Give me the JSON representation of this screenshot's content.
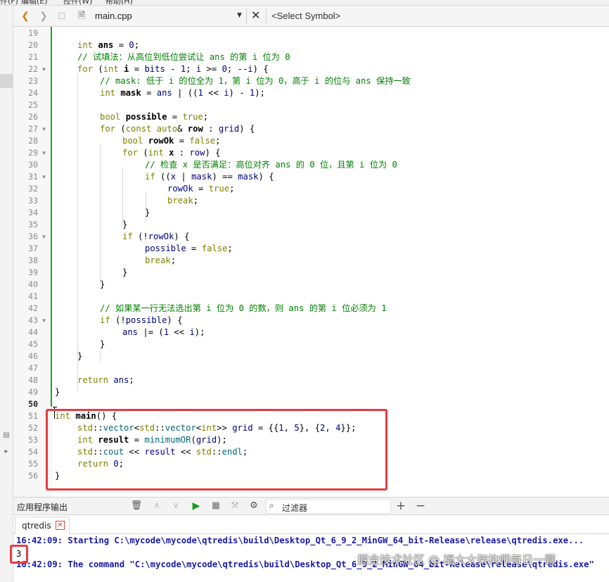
{
  "menubar": {
    "items": [
      "件(F)",
      "编辑(E)",
      "控件(W)",
      "帮助(H)"
    ]
  },
  "toolbar": {
    "file_name": "main.cpp",
    "symbol_placeholder": "<Select Symbol>",
    "icons": [
      "back-arrow-icon",
      "forward-arrow-icon",
      "lock-icon",
      "file-icon",
      "dropdown-icon",
      "close-icon"
    ]
  },
  "editor": {
    "current_line": 50,
    "lines": [
      {
        "n": "19",
        "text": ""
      },
      {
        "n": "20",
        "text": "int ans = 0;"
      },
      {
        "n": "21",
        "text": "// 试填法：从高位到低位尝试让 ans 的第 i 位为 0"
      },
      {
        "n": "22",
        "text": "for (int i = bits - 1; i >= 0; --i) {"
      },
      {
        "n": "23",
        "text": "// mask: 低于 i 的位全为 1，第 i 位为 0，高于 i 的位与 ans 保持一致"
      },
      {
        "n": "24",
        "text": "int mask = ans | ((1 << i) - 1);"
      },
      {
        "n": "25",
        "text": ""
      },
      {
        "n": "26",
        "text": "bool possible = true;"
      },
      {
        "n": "27",
        "text": "for (const auto& row : grid) {"
      },
      {
        "n": "28",
        "text": "bool rowOk = false;"
      },
      {
        "n": "29",
        "text": "for (int x : row) {"
      },
      {
        "n": "30",
        "text": "// 检查 x 是否满足：高位对齐 ans 的 0 位，且第 i 位为 0"
      },
      {
        "n": "31",
        "text": "if ((x | mask) == mask) {"
      },
      {
        "n": "32",
        "text": "rowOk = true;"
      },
      {
        "n": "33",
        "text": "break;"
      },
      {
        "n": "34",
        "text": "}"
      },
      {
        "n": "35",
        "text": "}"
      },
      {
        "n": "36",
        "text": "if (!rowOk) {"
      },
      {
        "n": "37",
        "text": "possible = false;"
      },
      {
        "n": "38",
        "text": "break;"
      },
      {
        "n": "39",
        "text": "}"
      },
      {
        "n": "40",
        "text": "}"
      },
      {
        "n": "41",
        "text": ""
      },
      {
        "n": "42",
        "text": "// 如果某一行无法选出第 i 位为 0 的数，则 ans 的第 i 位必须为 1"
      },
      {
        "n": "43",
        "text": "if (!possible) {"
      },
      {
        "n": "44",
        "text": "ans |= (1 << i);"
      },
      {
        "n": "45",
        "text": "}"
      },
      {
        "n": "46",
        "text": "}"
      },
      {
        "n": "47",
        "text": ""
      },
      {
        "n": "48",
        "text": "return ans;"
      },
      {
        "n": "49",
        "text": "}"
      },
      {
        "n": "50",
        "text": ""
      },
      {
        "n": "51",
        "text": "int main() {"
      },
      {
        "n": "52",
        "text": "std::vector<std::vector<int>> grid = {{1, 5}, {2, 4}};"
      },
      {
        "n": "53",
        "text": "int result = minimumOR(grid);"
      },
      {
        "n": "54",
        "text": "std::cout << result << std::endl;"
      },
      {
        "n": "55",
        "text": "return 0;"
      },
      {
        "n": "56",
        "text": "}"
      }
    ]
  },
  "output_pane": {
    "title": "应用程序输出",
    "filter_placeholder": "过滤器",
    "tab_label": "qtredis",
    "lines": [
      "16:42:09: Starting C:\\mycode\\mycode\\qtredis\\build\\Desktop_Qt_6_9_2_MinGW_64_bit-Release\\release\\qtredis.exe...",
      "3",
      "16:42:09: The command \"C:\\mycode\\mycode\\qtredis\\build\\Desktop_Qt_6_9_2_MinGW_64_bit-Release\\release\\qtredis.exe\""
    ]
  },
  "watermark": "掘金技术社区 @ 福大大架构师每日一题",
  "colors": {
    "highlight_box": "#e53c44",
    "change_bar": "#1fa31f",
    "comment": "#008000",
    "keyword": "#808000"
  }
}
